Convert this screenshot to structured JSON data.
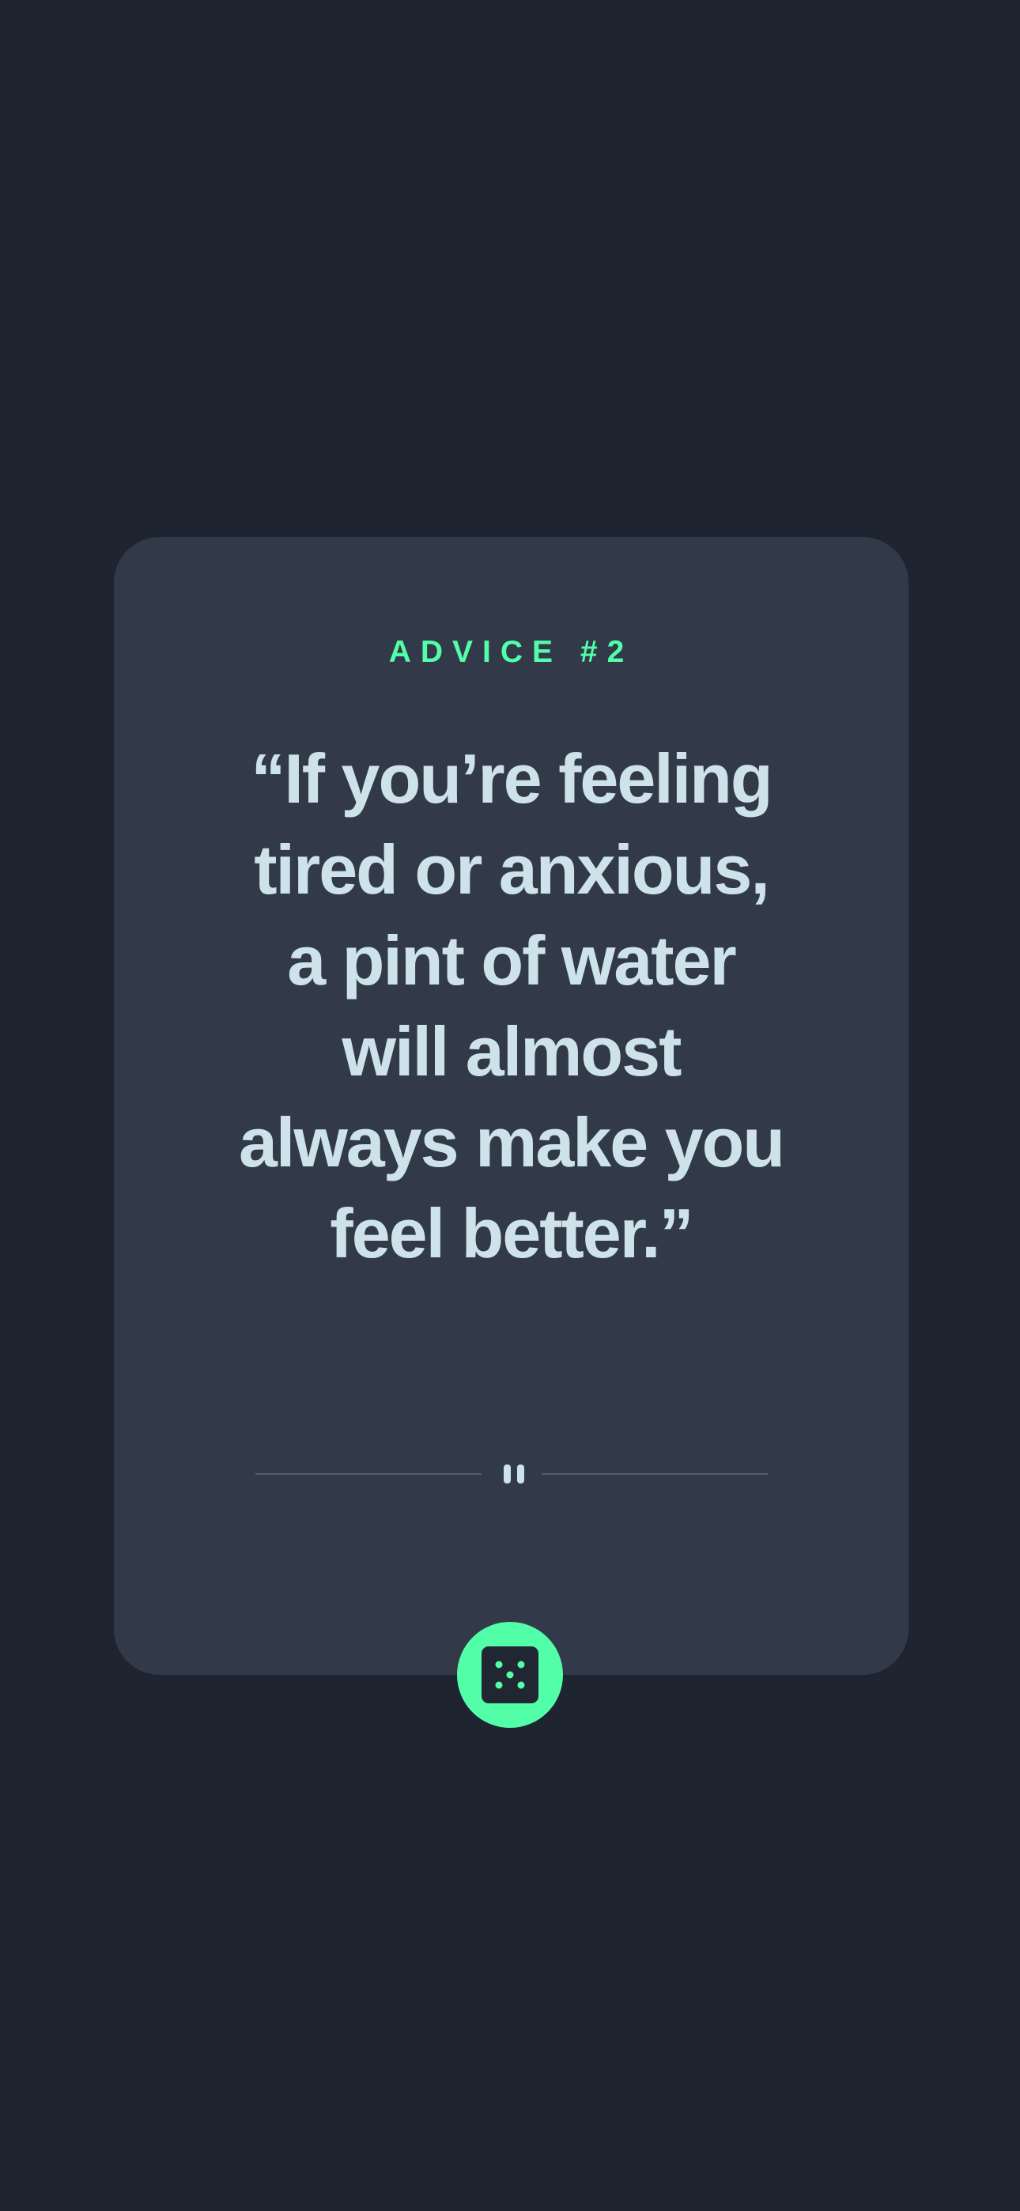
{
  "card": {
    "advice_label": "ADVICE #2",
    "quote": "“If you’re feeling tired or anxious, a pint of water will almost always make you feel better.”"
  },
  "divider": {
    "icon": "pause-icon"
  },
  "dice_button": {
    "icon": "dice-icon"
  },
  "colors": {
    "background": "#1f2530",
    "card": "#323a49",
    "accent": "#52ffa8",
    "text": "#cee3e9",
    "divider_line": "#4f5d74"
  }
}
